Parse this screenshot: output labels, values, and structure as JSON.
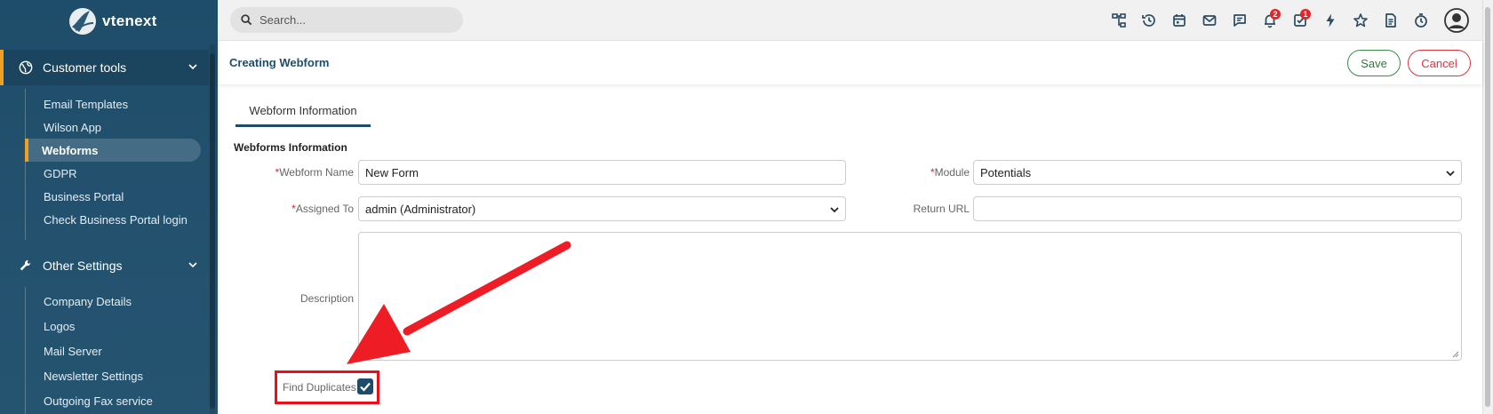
{
  "brand": {
    "name": "vtenext"
  },
  "search": {
    "placeholder": "Search..."
  },
  "sidebar": {
    "sections": [
      {
        "label": "Customer tools",
        "icon": "globe-icon"
      },
      {
        "label": "Other Settings",
        "icon": "wrench-icon"
      }
    ],
    "customer_tools_items": [
      {
        "label": "Email Templates"
      },
      {
        "label": "Wilson App"
      },
      {
        "label": "Webforms"
      },
      {
        "label": "GDPR"
      },
      {
        "label": "Business Portal"
      },
      {
        "label": "Check Business Portal login"
      }
    ],
    "other_settings_items": [
      {
        "label": "Company Details"
      },
      {
        "label": "Logos"
      },
      {
        "label": "Mail Server"
      },
      {
        "label": "Newsletter Settings"
      },
      {
        "label": "Outgoing Fax service"
      }
    ]
  },
  "topbar": {
    "icons": [
      "sitemap-icon",
      "history-icon",
      "calendar-icon",
      "mail-icon",
      "chat-icon",
      "bell-icon",
      "tasks-icon",
      "lightning-icon",
      "star-icon",
      "document-icon",
      "timer-icon",
      "user-avatar-icon"
    ],
    "notifications_badge": "2",
    "tasks_badge": "1"
  },
  "header": {
    "title": "Creating Webform",
    "save_label": "Save",
    "cancel_label": "Cancel"
  },
  "tabs": [
    {
      "label": "Webform Information"
    }
  ],
  "form": {
    "section_title": "Webforms Information",
    "required_mark": "*",
    "webform_name_label": "Webform Name",
    "webform_name_value": "New Form",
    "module_label": "Module",
    "module_value": "Potentials",
    "assigned_to_label": "Assigned To",
    "assigned_to_value": "admin (Administrator)",
    "return_url_label": "Return URL",
    "return_url_value": "",
    "description_label": "Description",
    "description_value": "",
    "find_duplicates_label": "Find Duplicates",
    "find_duplicates_checked": true
  },
  "annotation": {
    "highlight_color": "#e8101a",
    "arrow_color": "#ee1c25"
  }
}
